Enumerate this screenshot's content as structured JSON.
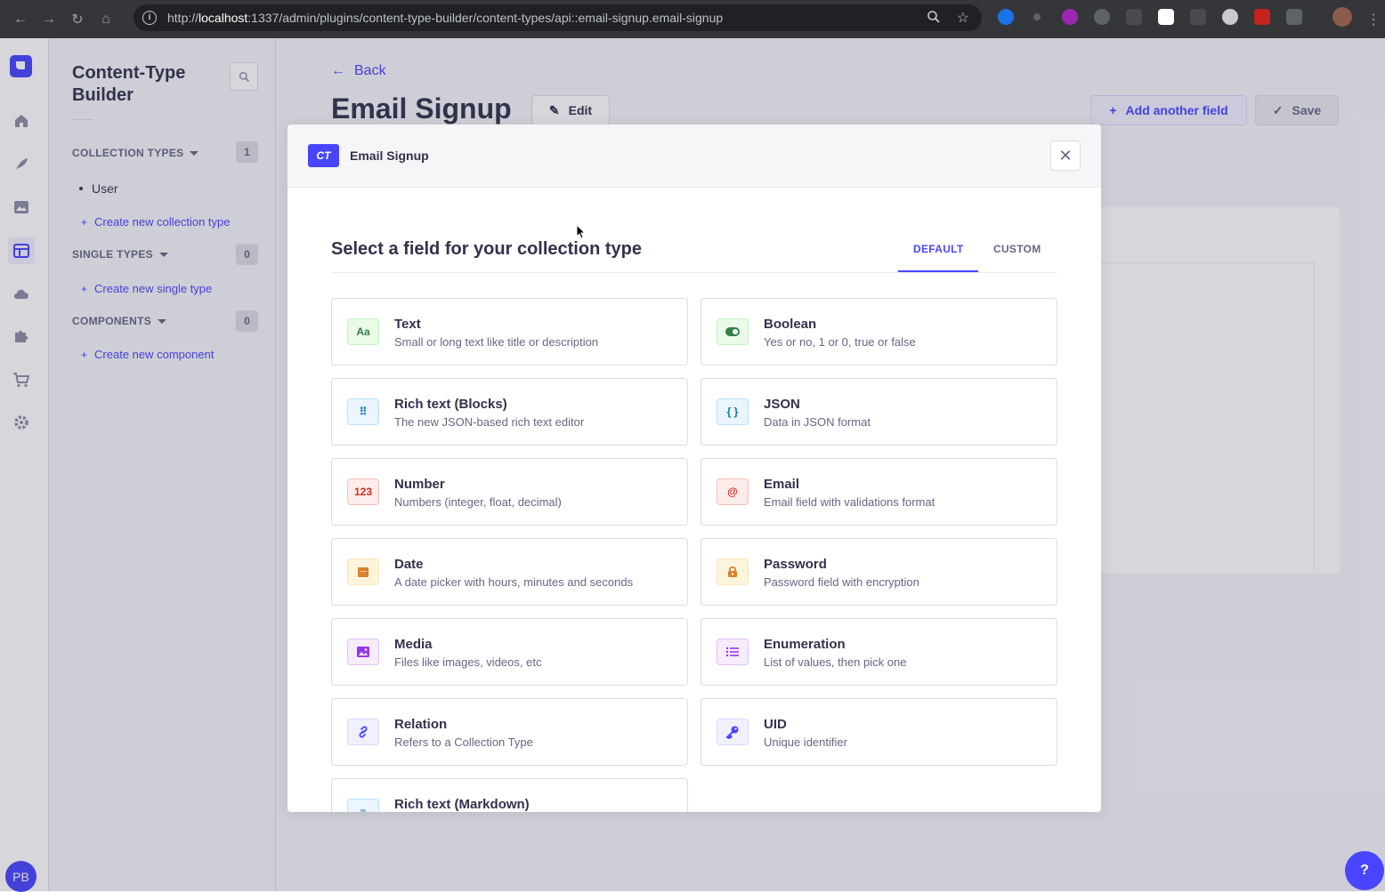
{
  "browser": {
    "url_prefix": "http://",
    "url_host": "localhost",
    "url_rest": ":1337/admin/plugins/content-type-builder/content-types/api::email-signup.email-signup"
  },
  "subnav": {
    "title": "Content-Type Builder",
    "collection_types": {
      "label": "COLLECTION TYPES",
      "count": "1",
      "items": [
        "User"
      ],
      "create_label": "Create new collection type"
    },
    "single_types": {
      "label": "SINGLE TYPES",
      "count": "0",
      "create_label": "Create new single type"
    },
    "components": {
      "label": "COMPONENTS",
      "count": "0",
      "create_label": "Create new component"
    },
    "user_initials": "PB"
  },
  "page": {
    "back_label": "Back",
    "title": "Email Signup",
    "edit_label": "Edit",
    "add_field_label": "Add another field",
    "save_label": "Save"
  },
  "modal": {
    "badge": "CT",
    "name": "Email Signup",
    "title": "Select a field for your collection type",
    "tabs": [
      "DEFAULT",
      "CUSTOM"
    ],
    "active_tab": "DEFAULT",
    "fields": [
      {
        "name": "Text",
        "desc": "Small or long text like title or description",
        "icon": "text-icon",
        "glyph": "Aa",
        "color": "#328048",
        "bg": "#eafbe7",
        "border": "#c6f0c2"
      },
      {
        "name": "Boolean",
        "desc": "Yes or no, 1 or 0, true or false",
        "icon": "toggle-icon",
        "glyph": "",
        "color": "#328048",
        "bg": "#eafbe7",
        "border": "#c6f0c2"
      },
      {
        "name": "Rich text (Blocks)",
        "desc": "The new JSON-based rich text editor",
        "icon": "blocks-icon",
        "glyph": "⠿",
        "color": "#0c75af",
        "bg": "#eaf5ff",
        "border": "#b8e1ff"
      },
      {
        "name": "JSON",
        "desc": "Data in JSON format",
        "icon": "json-icon",
        "glyph": "{ }",
        "color": "#0c75af",
        "bg": "#eaf5ff",
        "border": "#b8e1ff"
      },
      {
        "name": "Number",
        "desc": "Numbers (integer, float, decimal)",
        "icon": "number-icon",
        "glyph": "123",
        "color": "#d02b20",
        "bg": "#fcecea",
        "border": "#f5c0b8"
      },
      {
        "name": "Email",
        "desc": "Email field with validations format",
        "icon": "at-icon",
        "glyph": "@",
        "color": "#d02b20",
        "bg": "#fcecea",
        "border": "#f5c0b8"
      },
      {
        "name": "Date",
        "desc": "A date picker with hours, minutes and seconds",
        "icon": "calendar-icon",
        "glyph": "",
        "color": "#d9822f",
        "bg": "#fdf4dc",
        "border": "#fae7b9"
      },
      {
        "name": "Password",
        "desc": "Password field with encryption",
        "icon": "lock-icon",
        "glyph": "",
        "color": "#d9822f",
        "bg": "#fdf4dc",
        "border": "#fae7b9"
      },
      {
        "name": "Media",
        "desc": "Files like images, videos, etc",
        "icon": "image-icon",
        "glyph": "",
        "color": "#9736e8",
        "bg": "#f6ecfc",
        "border": "#e0c1f4"
      },
      {
        "name": "Enumeration",
        "desc": "List of values, then pick one",
        "icon": "list-icon",
        "glyph": "",
        "color": "#9736e8",
        "bg": "#f6ecfc",
        "border": "#e0c1f4"
      },
      {
        "name": "Relation",
        "desc": "Refers to a Collection Type",
        "icon": "link-icon",
        "glyph": "",
        "color": "#4945ff",
        "bg": "#f0f0ff",
        "border": "#d9d8ff"
      },
      {
        "name": "UID",
        "desc": "Unique identifier",
        "icon": "key-icon",
        "glyph": "",
        "color": "#4945ff",
        "bg": "#f0f0ff",
        "border": "#d9d8ff"
      },
      {
        "name": "Rich text (Markdown)",
        "desc": "",
        "icon": "markdown-icon",
        "glyph": "≡",
        "color": "#0c75af",
        "bg": "#eaf5ff",
        "border": "#b8e1ff"
      }
    ]
  }
}
